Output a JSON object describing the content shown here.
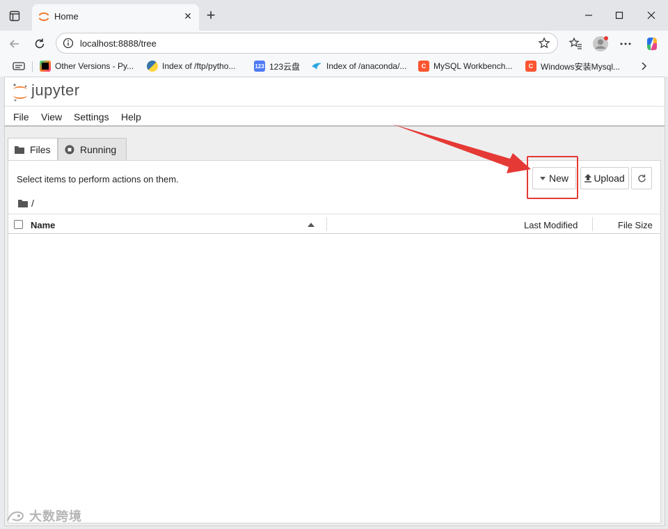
{
  "browser": {
    "tab_title": "Home",
    "url": "localhost:8888/tree",
    "bookmarks": [
      {
        "label": "Other Versions - Py...",
        "icon": "pycharm-icon",
        "color": "#000000"
      },
      {
        "label": "Index of /ftp/pytho...",
        "icon": "python-icon",
        "color": "#3776ab"
      },
      {
        "label": "123云盘",
        "icon": "pan123-icon",
        "color": "#4f7cf5"
      },
      {
        "label": "Index of /anaconda/...",
        "icon": "anaconda-icon",
        "color": "#2aa8e0"
      },
      {
        "label": "MySQL Workbench...",
        "icon": "csdn-icon",
        "color": "#fc5531"
      },
      {
        "label": "Windows安装Mysql...",
        "icon": "csdn-icon",
        "color": "#fc5531"
      }
    ]
  },
  "jupyter": {
    "logo_text": "jupyter",
    "menu": [
      "File",
      "View",
      "Settings",
      "Help"
    ],
    "tabs": {
      "files": "Files",
      "running": "Running"
    },
    "hint": "Select items to perform actions on them.",
    "buttons": {
      "new": "New",
      "upload": "Upload"
    },
    "breadcrumb": "/",
    "columns": {
      "name": "Name",
      "last_modified": "Last Modified",
      "file_size": "File Size"
    }
  },
  "watermark": "大数跨境",
  "colors": {
    "accent": "#f37726",
    "annotation": "#e53935"
  }
}
